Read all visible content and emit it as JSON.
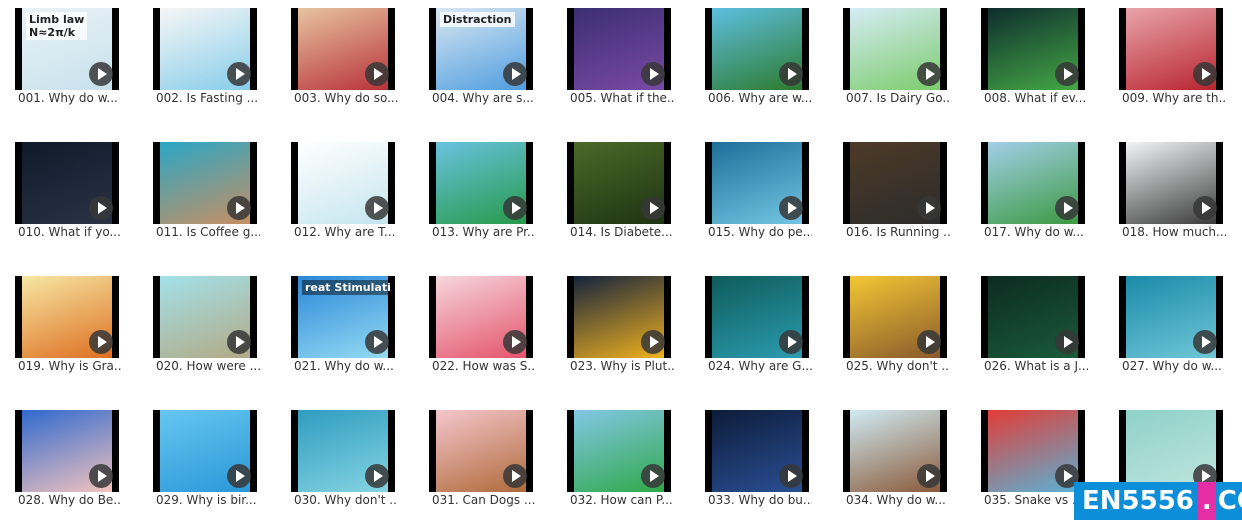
{
  "videos": [
    {
      "label": "001. Why do w...",
      "colors": [
        "#e9f3f7",
        "#c7e1ec"
      ],
      "overlay": "Limb law\nN≈2π/k"
    },
    {
      "label": "002. Is Fasting ...",
      "colors": [
        "#f6f6f6",
        "#87cdea"
      ]
    },
    {
      "label": "003. Why do so...",
      "colors": [
        "#e7c3a2",
        "#b83238"
      ]
    },
    {
      "label": "004. Why are s...",
      "colors": [
        "#d9e7f2",
        "#4f9ddf"
      ],
      "overlay": "Distraction"
    },
    {
      "label": "005. What if the...",
      "colors": [
        "#3b2e72",
        "#7a4aa5"
      ]
    },
    {
      "label": "006. Why are w...",
      "colors": [
        "#5dbfe0",
        "#2d7a2d"
      ]
    },
    {
      "label": "007. Is Dairy Go...",
      "colors": [
        "#d5ecf5",
        "#7ccc6c"
      ]
    },
    {
      "label": "008. What if ev...",
      "colors": [
        "#0d2d2e",
        "#45a845"
      ]
    },
    {
      "label": "009. Why are th...",
      "colors": [
        "#e8a4a9",
        "#b8242f"
      ]
    },
    {
      "label": "010. What if yo...",
      "colors": [
        "#0e1a2a",
        "#2a3346"
      ]
    },
    {
      "label": "011. Is Coffee g...",
      "colors": [
        "#2aa7c6",
        "#c78f62"
      ]
    },
    {
      "label": "012. Why are T...",
      "colors": [
        "#ffffff",
        "#c5e5ef"
      ]
    },
    {
      "label": "013. Why are Pr...",
      "colors": [
        "#6ac2df",
        "#259a4a"
      ]
    },
    {
      "label": "014. Is Diabete...",
      "colors": [
        "#4a6a28",
        "#1e3312"
      ]
    },
    {
      "label": "015. Why do pe...",
      "colors": [
        "#1d6f9a",
        "#73c6e2"
      ]
    },
    {
      "label": "016. Is Running ...",
      "colors": [
        "#4d3a26",
        "#2c2c2c"
      ]
    },
    {
      "label": "017. Why do w...",
      "colors": [
        "#a2cfe8",
        "#3c9a42"
      ]
    },
    {
      "label": "018. How much...",
      "colors": [
        "#f2f4f5",
        "#3b3b3b"
      ]
    },
    {
      "label": "019. Why is Gra...",
      "colors": [
        "#f7e7a4",
        "#dd6f21"
      ]
    },
    {
      "label": "020. How were ...",
      "colors": [
        "#a3e1ea",
        "#b2aa85"
      ]
    },
    {
      "label": "021. Why do w...",
      "colors": [
        "#2b87d7",
        "#94dbf4"
      ],
      "overlay": "reat Stimulati",
      "dark": true
    },
    {
      "label": "022. How was S...",
      "colors": [
        "#f6d6dc",
        "#e4536b"
      ]
    },
    {
      "label": "023. Why is Plut...",
      "colors": [
        "#15233d",
        "#f0b11f"
      ]
    },
    {
      "label": "024. Why are G...",
      "colors": [
        "#0e5c5a",
        "#2c9bb0"
      ]
    },
    {
      "label": "025. Why don't ...",
      "colors": [
        "#f3c734",
        "#895a2c"
      ]
    },
    {
      "label": "026. What is a J...",
      "colors": [
        "#0c2b22",
        "#1a5a3a"
      ]
    },
    {
      "label": "027. Why do w...",
      "colors": [
        "#1a8aa8",
        "#70c7d8"
      ]
    },
    {
      "label": "028. Why do Be...",
      "colors": [
        "#3069cf",
        "#f2c3bd"
      ]
    },
    {
      "label": "029. Why is bir...",
      "colors": [
        "#66c6f0",
        "#2a98d8"
      ]
    },
    {
      "label": "030. Why don't ...",
      "colors": [
        "#2f9cc0",
        "#85d4e2"
      ]
    },
    {
      "label": "031. Can Dogs ...",
      "colors": [
        "#f4c6cc",
        "#b06a3a"
      ]
    },
    {
      "label": "032. How can P...",
      "colors": [
        "#83c7e5",
        "#2fa94a"
      ]
    },
    {
      "label": "033. Why do bu...",
      "colors": [
        "#0d1c3a",
        "#2a4f94"
      ]
    },
    {
      "label": "034. Why do w...",
      "colors": [
        "#cfeaf2",
        "#8a5a3a"
      ]
    },
    {
      "label": "035. Snake vs ...",
      "colors": [
        "#e23c36",
        "#5ab2d5"
      ]
    },
    {
      "label": "",
      "colors": [
        "#8fd1c8",
        "#bfe6df"
      ]
    }
  ],
  "watermark": {
    "part1": "EN5556",
    "part2": ".",
    "part3": "COM"
  }
}
